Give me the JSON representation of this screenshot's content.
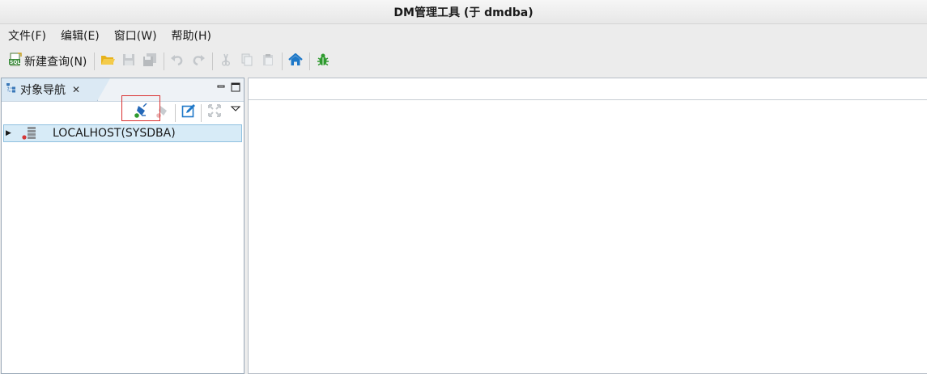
{
  "window": {
    "title": "DM管理工具 (于 dmdba)"
  },
  "menu": {
    "items": [
      {
        "label": "文件(F)"
      },
      {
        "label": "编辑(E)"
      },
      {
        "label": "窗口(W)"
      },
      {
        "label": "帮助(H)"
      }
    ]
  },
  "toolbar": {
    "new_query_label": "新建查询(N)",
    "icons": [
      "sql-file-icon",
      "open-folder-icon",
      "save-icon",
      "save-all-icon",
      "undo-icon",
      "redo-icon",
      "cut-icon",
      "copy-icon",
      "paste-icon",
      "home-icon",
      "bug-icon"
    ]
  },
  "navigator": {
    "tab_label": "对象导航",
    "tree": [
      {
        "label": "LOCALHOST(SYSDBA)"
      }
    ]
  },
  "colors": {
    "selection_bg": "#d7ebf7",
    "highlight_box": "#d93030",
    "home_icon": "#1e78c8",
    "bug_icon": "#2e9a2e",
    "folder_icon": "#e7b21b"
  }
}
